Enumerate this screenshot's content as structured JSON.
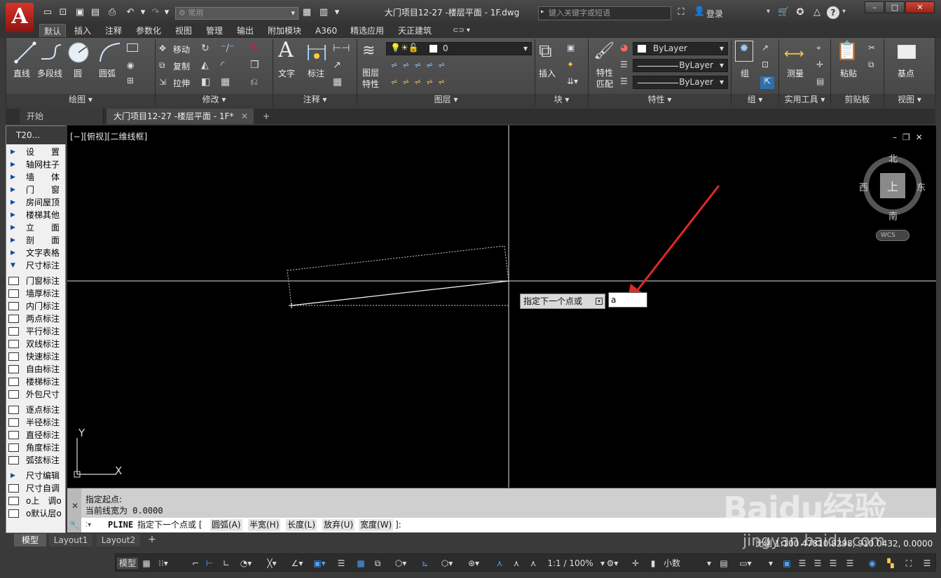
{
  "window": {
    "title": "大门项目12-27 -楼层平面 - 1F.dwg",
    "workspace": "常用",
    "search_placeholder": "键入关键字或短语",
    "login_label": "登录",
    "help_label": "?",
    "min": "–",
    "max": "□",
    "close": "✕"
  },
  "app_logo_letter": "A",
  "ribbon_tabs": [
    "默认",
    "插入",
    "注释",
    "参数化",
    "视图",
    "管理",
    "输出",
    "附加模块",
    "A360",
    "精选应用",
    "天正建筑"
  ],
  "panels": {
    "draw": {
      "title": "绘图 ▾",
      "tools": [
        "直线",
        "多段线",
        "圆",
        "圆弧"
      ]
    },
    "modify": {
      "title": "修改 ▾",
      "tools": [
        "移动",
        "复制",
        "拉伸"
      ]
    },
    "annot": {
      "title": "注释 ▾",
      "tools": [
        "文字",
        "标注"
      ]
    },
    "layers": {
      "title": "图层 ▾",
      "layer_props": "图层\n特性",
      "current_layer": "0"
    },
    "block": {
      "title": "块 ▾",
      "insert": "插入"
    },
    "props": {
      "title": "特性 ▾",
      "match": "特性\n匹配",
      "color": "ByLayer",
      "linetype": "ByLayer",
      "lineweight": "ByLayer"
    },
    "group": {
      "title": "组 ▾",
      "tool": "组"
    },
    "util": {
      "title": "实用工具 ▾",
      "tool": "测量"
    },
    "clip": {
      "title": "剪贴板",
      "tool": "粘贴"
    },
    "view": {
      "title": "视图 ▾",
      "tool": "基点"
    }
  },
  "doc_tabs": [
    "开始",
    "大门项目12-27 -楼层平面 - 1F*"
  ],
  "palette": {
    "header": "T20...",
    "items": [
      {
        "label": "设　　置",
        "kind": "arrow"
      },
      {
        "label": "轴网柱子",
        "kind": "arrow"
      },
      {
        "label": "墙　　体",
        "kind": "arrow"
      },
      {
        "label": "门　　窗",
        "kind": "arrow"
      },
      {
        "label": "房间屋顶",
        "kind": "arrow"
      },
      {
        "label": "楼梯其他",
        "kind": "arrow"
      },
      {
        "label": "立　　面",
        "kind": "arrow"
      },
      {
        "label": "剖　　面",
        "kind": "arrow"
      },
      {
        "label": "文字表格",
        "kind": "arrow"
      },
      {
        "label": "尺寸标注",
        "kind": "open"
      },
      {
        "label": "门窗标注",
        "kind": "icon"
      },
      {
        "label": "墙厚标注",
        "kind": "icon"
      },
      {
        "label": "内门标注",
        "kind": "icon"
      },
      {
        "label": "两点标注",
        "kind": "icon"
      },
      {
        "label": "平行标注",
        "kind": "icon"
      },
      {
        "label": "双线标注",
        "kind": "icon"
      },
      {
        "label": "快速标注",
        "kind": "icon"
      },
      {
        "label": "自由标注",
        "kind": "icon"
      },
      {
        "label": "楼梯标注",
        "kind": "icon"
      },
      {
        "label": "外包尺寸",
        "kind": "icon"
      },
      {
        "label": "逐点标注",
        "kind": "icon"
      },
      {
        "label": "半径标注",
        "kind": "icon"
      },
      {
        "label": "直径标注",
        "kind": "icon"
      },
      {
        "label": "角度标注",
        "kind": "icon"
      },
      {
        "label": "弧弦标注",
        "kind": "icon"
      },
      {
        "label": "尺寸编辑",
        "kind": "arrow"
      },
      {
        "label": "尺寸自调",
        "kind": "icon"
      },
      {
        "label": "o上　调o",
        "kind": "icon"
      },
      {
        "label": "o默认层o",
        "kind": "icon"
      }
    ]
  },
  "viewport": {
    "label": "[−][俯视][二维线框]",
    "compass": {
      "n": "北",
      "s": "南",
      "e": "东",
      "w": "西",
      "top": "上",
      "wcs": "WCS"
    },
    "ucs_x": "X",
    "ucs_y": "Y"
  },
  "tooltip": {
    "prompt": "指定下一个点或",
    "input": "a"
  },
  "command": {
    "history1": "指定起点:",
    "history2": "当前线宽为 0.0000",
    "cmd": "PLINE",
    "prompt": "指定下一个点或 [",
    "options": [
      "圆弧(A)",
      "半宽(H)",
      "长度(L)",
      "放弃(U)",
      "宽度(W)"
    ],
    "end": "]:"
  },
  "layout_tabs": [
    "模型",
    "Layout1",
    "Layout2"
  ],
  "status": {
    "model": "模型",
    "coords": "比例 1:100  47810.8298, 910.0432, 0.0000",
    "scale": "1:1 / 100%",
    "units": "小数"
  },
  "watermark": "Baidu经验",
  "watermark_url": "jingyan.baidu.com",
  "colors": {
    "accent": "#1e6fd4",
    "arrow": "#e02828",
    "canvas": "#000000"
  }
}
